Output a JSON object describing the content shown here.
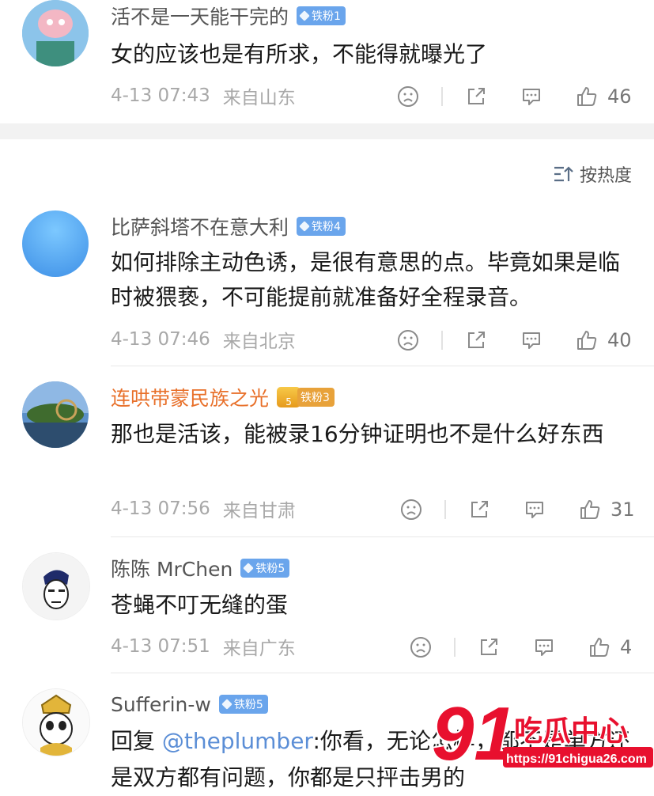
{
  "sort": {
    "label": "按热度"
  },
  "comments": [
    {
      "username": "活不是一天能干完的",
      "badge": "铁粉1",
      "text": "女的应该也是有所求，不能得就曝光了",
      "time": "4-13 07:43",
      "location": "来自山东",
      "likes": "46"
    },
    {
      "username": "比萨斜塔不在意大利",
      "badge": "铁粉4",
      "text": "如何排除主动色诱，是很有意思的点。毕竟如果是临时被猥亵，不可能提前就准备好全程录音。",
      "time": "4-13 07:46",
      "location": "来自北京",
      "likes": "40"
    },
    {
      "username": "连哄带蒙民族之光",
      "badge": "铁粉3",
      "crown_level": "5",
      "text": "那也是活该，能被录16分钟证明也不是什么好东西",
      "time": "4-13 07:56",
      "location": "来自甘肃",
      "likes": "31"
    },
    {
      "username": "陈陈 MrChen",
      "badge": "铁粉5",
      "text": "苍蝇不叮无缝的蛋",
      "time": "4-13 07:51",
      "location": "来自广东",
      "likes": "4"
    },
    {
      "username": "Sufferin-w",
      "badge": "铁粉5",
      "reply_prefix": "回复 ",
      "mention": "@theplumber",
      "text_after": ":你看，无论怎样，都不是单方还是双方都有问题，你都是只抨击男的"
    }
  ],
  "watermark": {
    "logo": "91吃瓜中心",
    "url": "https://91chigua26.com"
  },
  "icons": [
    "frown-icon",
    "share-icon",
    "comment-icon",
    "thumbs-up-icon",
    "sort-icon"
  ],
  "colors": {
    "gold_name": "#e8702a",
    "badge": "#6aa5ec",
    "mention": "#5b8ed6",
    "watermark_red": "#e8102e"
  }
}
